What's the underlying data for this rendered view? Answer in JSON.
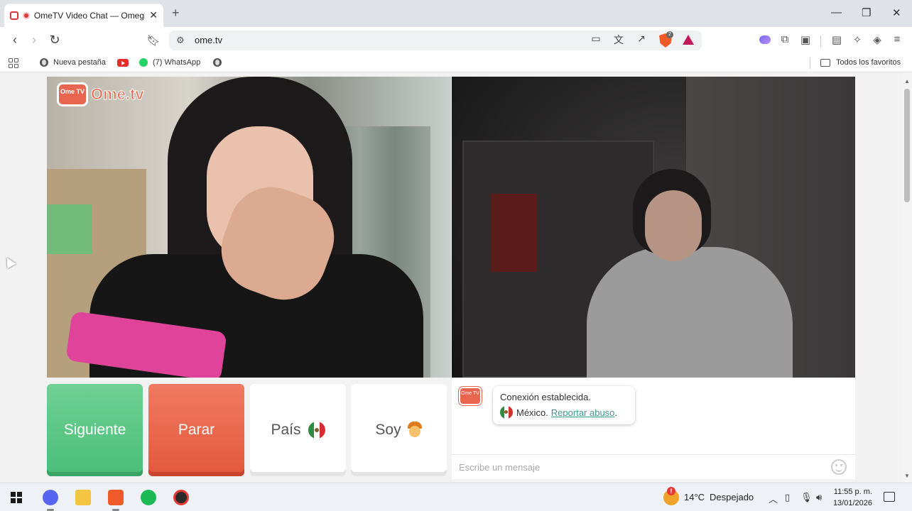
{
  "browser": {
    "tab": {
      "title": "OmeTV Video Chat — Omegle"
    },
    "url": "ome.tv",
    "bookmarks": [
      {
        "label": "Nueva pestaña",
        "icon": "globe-icon"
      },
      {
        "label": "",
        "icon": "youtube-icon"
      },
      {
        "label": "(7) WhatsApp",
        "icon": "whatsapp-icon"
      },
      {
        "label": "",
        "icon": "globe-icon"
      }
    ],
    "favorites_label": "Todos los favoritos",
    "shield_badge": "2"
  },
  "video": {
    "logo_text": "Ome.tv",
    "logo_badge": "Ome TV"
  },
  "controls": {
    "next_label": "Siguiente",
    "stop_label": "Parar",
    "country_label": "País",
    "gender_label": "Soy",
    "country_flag": "mexico-flag-icon",
    "gender_icon": "boy-icon"
  },
  "chat": {
    "status": "Conexión establecida.",
    "country": "México.",
    "report_link": "Reportar abuso",
    "report_suffix": ".",
    "input_placeholder": "Escribe un mensaje"
  },
  "taskbar": {
    "weather_temp": "14°C",
    "weather_desc": "Despejado",
    "time": "11:55 p. m.",
    "date": "13/01/2026"
  },
  "colors": {
    "next": "#4bbd79",
    "stop": "#e3583c",
    "brand": "#e8664f",
    "report_link": "#3a9c8f"
  }
}
